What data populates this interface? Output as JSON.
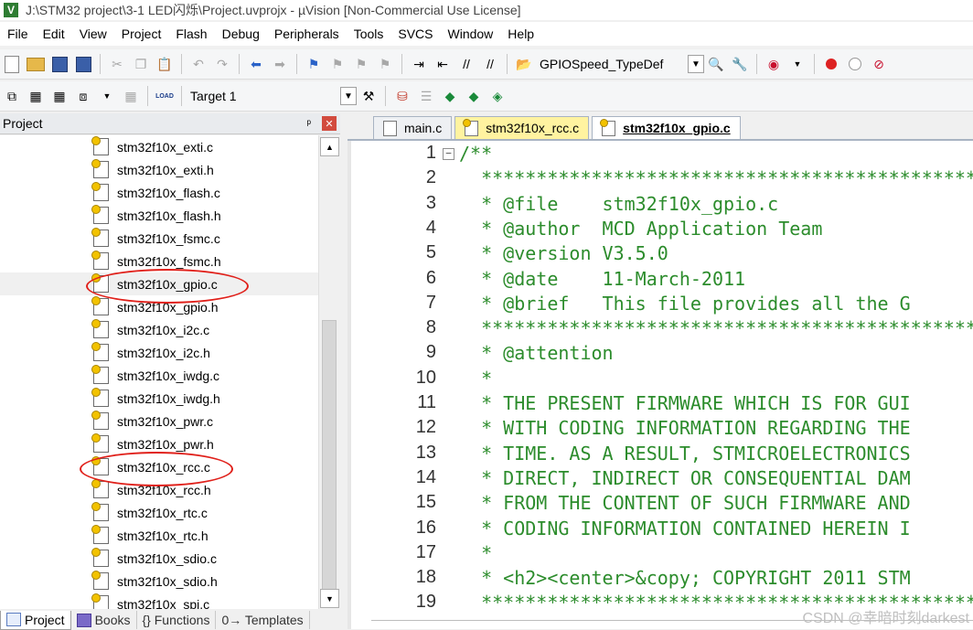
{
  "window": {
    "title": "J:\\STM32 project\\3-1 LED闪烁\\Project.uvprojx - µVision  [Non-Commercial Use License]",
    "app_icon": "V"
  },
  "menu": [
    "File",
    "Edit",
    "View",
    "Project",
    "Flash",
    "Debug",
    "Peripherals",
    "Tools",
    "SVCS",
    "Window",
    "Help"
  ],
  "toolbar1": {
    "find_combo_value": "GPIOSpeed_TypeDef"
  },
  "toolbar2": {
    "load_label": "LOAD",
    "target_combo_value": "Target 1"
  },
  "project_panel": {
    "title": "Project",
    "pin_glyph": "ᵖ",
    "close_glyph": "✕",
    "files": [
      "stm32f10x_exti.c",
      "stm32f10x_exti.h",
      "stm32f10x_flash.c",
      "stm32f10x_flash.h",
      "stm32f10x_fsmc.c",
      "stm32f10x_fsmc.h",
      "stm32f10x_gpio.c",
      "stm32f10x_gpio.h",
      "stm32f10x_i2c.c",
      "stm32f10x_i2c.h",
      "stm32f10x_iwdg.c",
      "stm32f10x_iwdg.h",
      "stm32f10x_pwr.c",
      "stm32f10x_pwr.h",
      "stm32f10x_rcc.c",
      "stm32f10x_rcc.h",
      "stm32f10x_rtc.c",
      "stm32f10x_rtc.h",
      "stm32f10x_sdio.c",
      "stm32f10x_sdio.h",
      "stm32f10x_spi.c"
    ],
    "selected_file": "stm32f10x_gpio.c",
    "bottom_tabs": [
      "Project",
      "Books",
      "{} Functions",
      "0→ Templates"
    ]
  },
  "editor": {
    "tabs": [
      {
        "label": "main.c",
        "state": "normal"
      },
      {
        "label": "stm32f10x_rcc.c",
        "state": "modified"
      },
      {
        "label": "stm32f10x_gpio.c",
        "state": "active"
      }
    ],
    "fold_glyph": "−",
    "lines": [
      {
        "n": "1",
        "text": "/**"
      },
      {
        "n": "2",
        "text": "  ******************************************************"
      },
      {
        "n": "3",
        "text": "  * @file    stm32f10x_gpio.c"
      },
      {
        "n": "4",
        "text": "  * @author  MCD Application Team"
      },
      {
        "n": "5",
        "text": "  * @version V3.5.0"
      },
      {
        "n": "6",
        "text": "  * @date    11-March-2011"
      },
      {
        "n": "7",
        "text": "  * @brief   This file provides all the G"
      },
      {
        "n": "8",
        "text": "  ******************************************************"
      },
      {
        "n": "9",
        "text": "  * @attention"
      },
      {
        "n": "10",
        "text": "  *"
      },
      {
        "n": "11",
        "text": "  * THE PRESENT FIRMWARE WHICH IS FOR GUI"
      },
      {
        "n": "12",
        "text": "  * WITH CODING INFORMATION REGARDING THE"
      },
      {
        "n": "13",
        "text": "  * TIME. AS A RESULT, STMICROELECTRONICS"
      },
      {
        "n": "14",
        "text": "  * DIRECT, INDIRECT OR CONSEQUENTIAL DAM"
      },
      {
        "n": "15",
        "text": "  * FROM THE CONTENT OF SUCH FIRMWARE AND"
      },
      {
        "n": "16",
        "text": "  * CODING INFORMATION CONTAINED HEREIN I"
      },
      {
        "n": "17",
        "text": "  *"
      },
      {
        "n": "18",
        "text": "  * <h2><center>&copy; COPYRIGHT 2011 STM"
      },
      {
        "n": "19",
        "text": "  ******************************************************"
      }
    ]
  },
  "watermark": "CSDN @幸暗时刻darkest",
  "annotations": {
    "highlighted_files": [
      "stm32f10x_gpio.c",
      "stm32f10x_rcc.c"
    ],
    "color": "#e0201a"
  },
  "colors": {
    "comment_green": "#2c8c2c",
    "modified_tab": "#fff3a0"
  }
}
